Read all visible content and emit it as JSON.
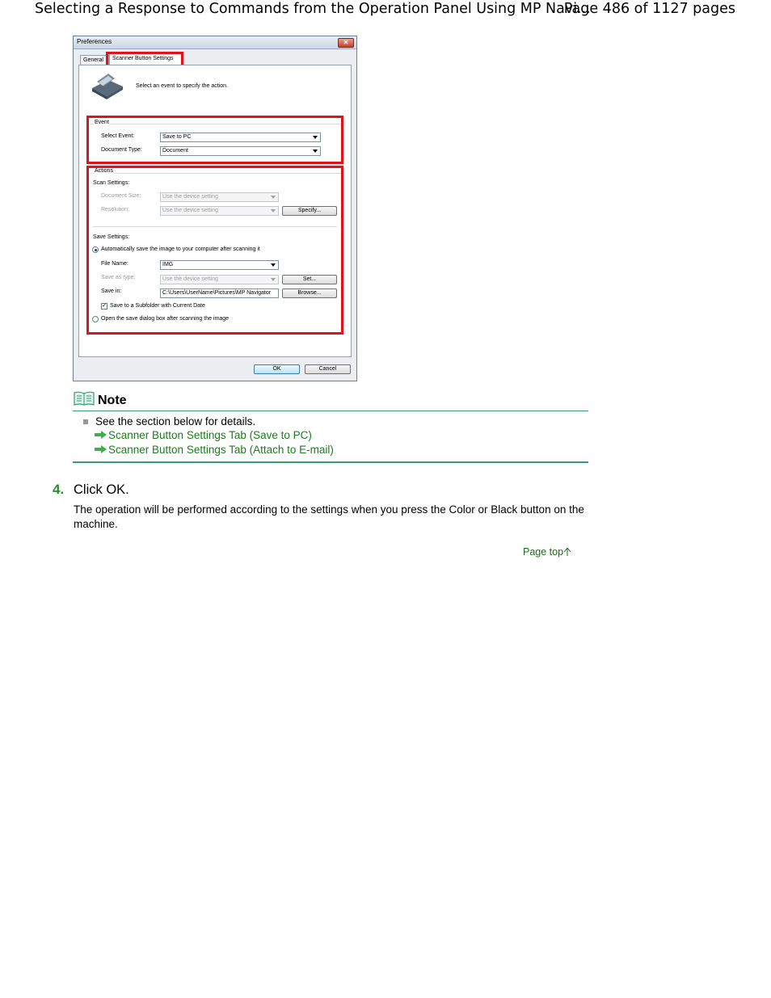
{
  "header": {
    "title": "Selecting a Response to Commands from the Operation Panel Using MP Navi...",
    "page": "Page 486 of 1127 pages"
  },
  "dialog": {
    "title": "Preferences",
    "tabs": [
      "General",
      "Scanner Button Settings"
    ],
    "instruction": "Select an event to specify the action.",
    "event": {
      "group_label": "Event",
      "select_event_label": "Select Event:",
      "select_event_value": "Save to PC",
      "document_type_label": "Document Type:",
      "document_type_value": "Document"
    },
    "actions": {
      "group_label": "Actions",
      "scan_settings_label": "Scan Settings:",
      "document_size_label": "Document Size:",
      "document_size_value": "Use the device setting",
      "resolution_label": "Resolution:",
      "resolution_value": "Use the device setting",
      "specify_button": "Specify...",
      "save_settings_label": "Save Settings:",
      "auto_save_option": "Automatically save the image to your computer after scanning it",
      "file_name_label": "File Name:",
      "file_name_value": "IMG",
      "save_as_type_label": "Save as type:",
      "save_as_type_value": "Use the device setting",
      "set_button": "Set...",
      "save_in_label": "Save in:",
      "save_in_value": "C:\\Users\\UserName\\Pictures\\MP Navigator",
      "browse_button": "Browse...",
      "subfolder_checkbox": "Save to a Subfolder with Current Date",
      "open_dialog_option": "Open the save dialog box after scanning the image"
    },
    "ok_button": "OK",
    "cancel_button": "Cancel"
  },
  "note": {
    "title": "Note",
    "text": "See the section below for details.",
    "links": [
      "Scanner Button Settings Tab (Save to PC)",
      "Scanner Button Settings Tab (Attach to E-mail)"
    ]
  },
  "step": {
    "number": "4.",
    "title": "Click OK.",
    "body": "The operation will be performed according to the settings when you press the Color or Black button on the machine."
  },
  "page_top": "Page top",
  "colors": {
    "highlight": "#e0121a",
    "link": "#1f7a1f",
    "step_number": "#2a8a2a"
  }
}
